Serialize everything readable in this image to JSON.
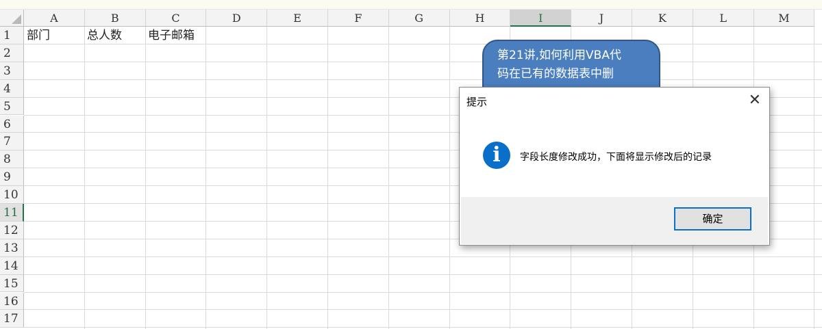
{
  "columns": [
    "A",
    "B",
    "C",
    "D",
    "E",
    "F",
    "G",
    "H",
    "I",
    "J",
    "K",
    "L",
    "M"
  ],
  "selected_column": "I",
  "rows": [
    "1",
    "2",
    "3",
    "4",
    "5",
    "6",
    "7",
    "8",
    "9",
    "10",
    "11",
    "12",
    "13",
    "14",
    "15",
    "16",
    "17"
  ],
  "selected_row": "11",
  "cells": {
    "A1": "部门",
    "B1": "总人数",
    "C1": "电子邮箱"
  },
  "callout": {
    "line1": "第21讲,如何利用VBA代",
    "line2": "码在已有的数据表中删"
  },
  "dialog": {
    "title": "提示",
    "close_icon": "close-icon",
    "icon": "info-icon",
    "icon_glyph": "i",
    "message": "字段长度修改成功，下面将显示修改后的记录",
    "ok_label": "确定"
  }
}
